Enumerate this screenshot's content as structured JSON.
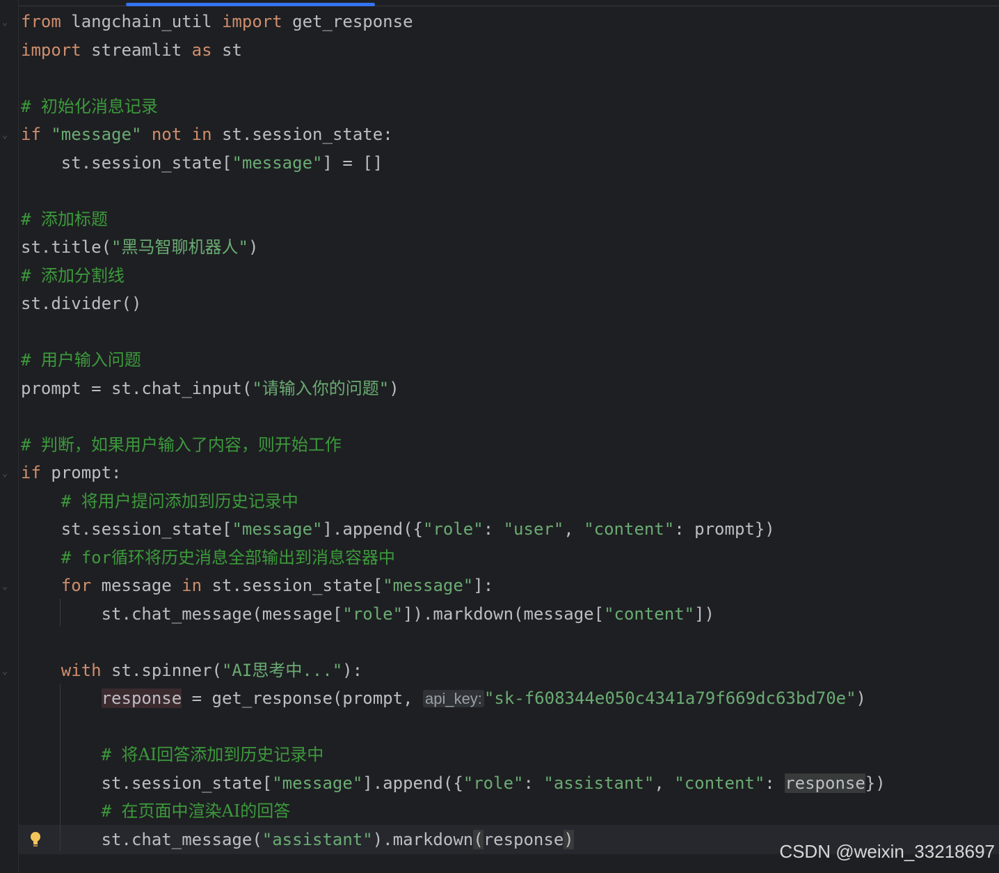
{
  "editor": {
    "language": "python",
    "lines": [
      {
        "indent": 0,
        "tokens": [
          [
            "kw",
            "from"
          ],
          [
            "sym",
            " langchain_util "
          ],
          [
            "kw",
            "import"
          ],
          [
            "sym",
            " get_response"
          ]
        ]
      },
      {
        "indent": 0,
        "tokens": [
          [
            "kw",
            "import"
          ],
          [
            "sym",
            " streamlit "
          ],
          [
            "kw",
            "as"
          ],
          [
            "sym",
            " st"
          ]
        ]
      },
      {
        "indent": 0,
        "tokens": []
      },
      {
        "indent": 0,
        "tokens": [
          [
            "cm",
            "# "
          ],
          [
            "cmcjk",
            "初始化消息记录"
          ]
        ]
      },
      {
        "indent": 0,
        "tokens": [
          [
            "kw",
            "if"
          ],
          [
            "sym",
            " "
          ],
          [
            "str",
            "\"message\""
          ],
          [
            "sym",
            " "
          ],
          [
            "kw",
            "not in"
          ],
          [
            "sym",
            " st.session_state:"
          ]
        ]
      },
      {
        "indent": 1,
        "tokens": [
          [
            "sym",
            "st.session_state["
          ],
          [
            "str",
            "\"message\""
          ],
          [
            "sym",
            "] = []"
          ]
        ]
      },
      {
        "indent": 0,
        "tokens": []
      },
      {
        "indent": 0,
        "tokens": [
          [
            "cm",
            "# "
          ],
          [
            "cmcjk",
            "添加标题"
          ]
        ]
      },
      {
        "indent": 0,
        "tokens": [
          [
            "sym",
            "st.title("
          ],
          [
            "str",
            "\""
          ],
          [
            "strcjk",
            "黑马智聊机器人"
          ],
          [
            "str",
            "\""
          ],
          [
            "sym",
            ")"
          ]
        ]
      },
      {
        "indent": 0,
        "tokens": [
          [
            "cm",
            "# "
          ],
          [
            "cmcjk",
            "添加分割线"
          ]
        ]
      },
      {
        "indent": 0,
        "tokens": [
          [
            "sym",
            "st.divider()"
          ]
        ]
      },
      {
        "indent": 0,
        "tokens": []
      },
      {
        "indent": 0,
        "tokens": [
          [
            "cm",
            "# "
          ],
          [
            "cmcjk",
            "用户输入问题"
          ]
        ]
      },
      {
        "indent": 0,
        "tokens": [
          [
            "sym",
            "prompt = st.chat_input("
          ],
          [
            "str",
            "\""
          ],
          [
            "strcjk",
            "请输入你的问题"
          ],
          [
            "str",
            "\""
          ],
          [
            "sym",
            ")"
          ]
        ]
      },
      {
        "indent": 0,
        "tokens": []
      },
      {
        "indent": 0,
        "tokens": [
          [
            "cm",
            "# "
          ],
          [
            "cmcjk",
            "判断，如果用户输入了内容，则开始工作"
          ]
        ]
      },
      {
        "indent": 0,
        "tokens": [
          [
            "kw",
            "if"
          ],
          [
            "sym",
            " prompt:"
          ]
        ]
      },
      {
        "indent": 1,
        "tokens": [
          [
            "cm",
            "# "
          ],
          [
            "cmcjk",
            "将用户提问添加到历史记录中"
          ]
        ]
      },
      {
        "indent": 1,
        "tokens": [
          [
            "sym",
            "st.session_state["
          ],
          [
            "str",
            "\"message\""
          ],
          [
            "sym",
            "].append({"
          ],
          [
            "str",
            "\"role\""
          ],
          [
            "sym",
            ": "
          ],
          [
            "str",
            "\"user\""
          ],
          [
            "sym",
            ", "
          ],
          [
            "str",
            "\"content\""
          ],
          [
            "sym",
            ": prompt})"
          ]
        ]
      },
      {
        "indent": 1,
        "tokens": [
          [
            "cm",
            "# for"
          ],
          [
            "cmcjk",
            "循环将历史消息全部输出到消息容器中"
          ]
        ]
      },
      {
        "indent": 1,
        "tokens": [
          [
            "kw",
            "for"
          ],
          [
            "sym",
            " message "
          ],
          [
            "kw",
            "in"
          ],
          [
            "sym",
            " st.session_state["
          ],
          [
            "str",
            "\"message\""
          ],
          [
            "sym",
            "]:"
          ]
        ]
      },
      {
        "indent": 2,
        "tokens": [
          [
            "sym",
            "st.chat_message(message["
          ],
          [
            "str",
            "\"role\""
          ],
          [
            "sym",
            "]).markdown(message["
          ],
          [
            "str",
            "\"content\""
          ],
          [
            "sym",
            "])"
          ]
        ]
      },
      {
        "indent": 0,
        "tokens": []
      },
      {
        "indent": 1,
        "tokens": [
          [
            "kw",
            "with"
          ],
          [
            "sym",
            " st.spinner("
          ],
          [
            "str",
            "\"AI"
          ],
          [
            "strcjk",
            "思考中"
          ],
          [
            "str",
            "...\""
          ],
          [
            "sym",
            "):"
          ]
        ]
      },
      {
        "indent": 2,
        "tokens": [
          [
            "hlvar",
            "response"
          ],
          [
            "sym",
            " = get_response(prompt, "
          ],
          [
            "hint",
            "api_key:"
          ],
          [
            "str",
            "\"sk-f608344e050c4341a79f669dc63bd70e\""
          ],
          [
            "sym",
            ")"
          ]
        ]
      },
      {
        "indent": 0,
        "tokens": []
      },
      {
        "indent": 2,
        "tokens": [
          [
            "cm",
            "# "
          ],
          [
            "cmcjk",
            "将AI回答添加到历史记录中"
          ]
        ]
      },
      {
        "indent": 2,
        "tokens": [
          [
            "sym",
            "st.session_state["
          ],
          [
            "str",
            "\"message\""
          ],
          [
            "sym",
            "].append({"
          ],
          [
            "str",
            "\"role\""
          ],
          [
            "sym",
            ": "
          ],
          [
            "str",
            "\"assistant\""
          ],
          [
            "sym",
            ", "
          ],
          [
            "str",
            "\"content\""
          ],
          [
            "sym",
            ": "
          ],
          [
            "hlref",
            "response"
          ],
          [
            "sym",
            "})"
          ]
        ]
      },
      {
        "indent": 2,
        "tokens": [
          [
            "cm",
            "# "
          ],
          [
            "cmcjk",
            "在页面中渲染AI的回答"
          ]
        ]
      },
      {
        "indent": 2,
        "tokens": [
          [
            "sym",
            "st.chat_message("
          ],
          [
            "str",
            "\"assistant\""
          ],
          [
            "sym",
            ").markdown"
          ],
          [
            "hlref",
            "("
          ],
          [
            "sym",
            "response"
          ],
          [
            "hlref",
            ")"
          ]
        ]
      }
    ]
  },
  "watermark": {
    "text": "CSDN @weixin_33218697"
  },
  "colors": {
    "background": "#1e1f22",
    "keyword": "#cf8e6d",
    "string": "#6aab73",
    "comment": "#3c9a3c",
    "text": "#bcbec4",
    "accent": "#3574f0"
  },
  "icons": {
    "fold_markers": "fold-chevron-icon",
    "intention": "lightbulb-icon"
  }
}
